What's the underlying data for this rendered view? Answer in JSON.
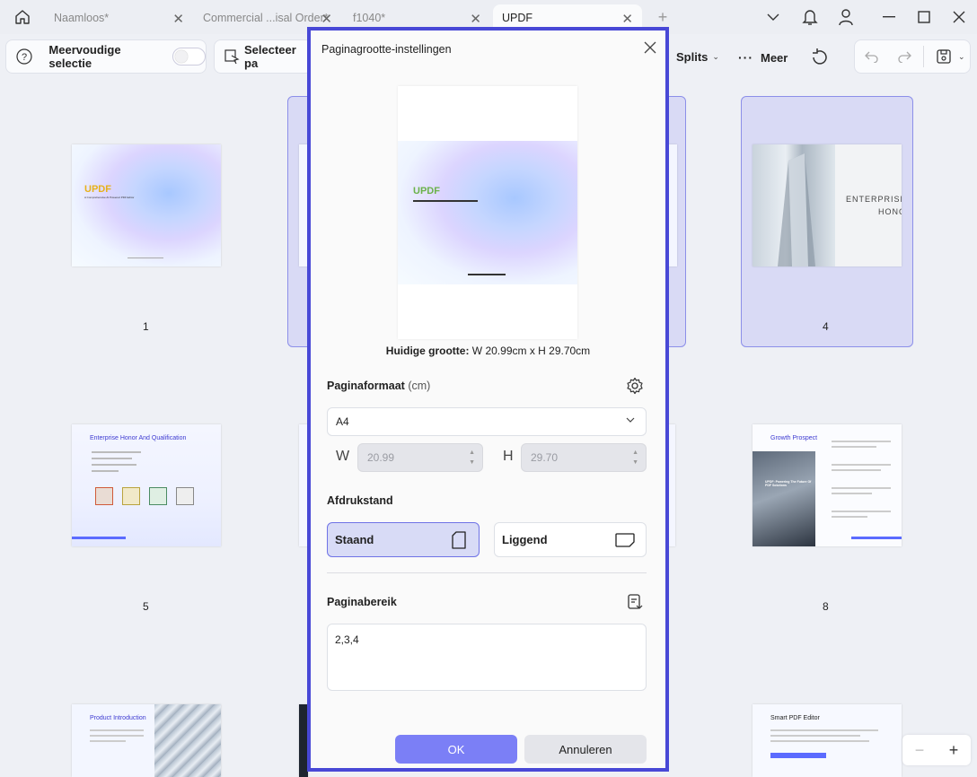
{
  "tabs": [
    {
      "label": "Naamloos*",
      "active": false
    },
    {
      "label": "Commercial ...isal Order*",
      "active": false
    },
    {
      "label": "f1040*",
      "active": false
    },
    {
      "label": "UPDF",
      "active": true
    }
  ],
  "toolbar": {
    "multi_select_label": "Meervoudige selectie",
    "select_pages_label": "Selecteer pa",
    "split_label": "Splits",
    "more_label": "Meer"
  },
  "pages": [
    {
      "number": "1",
      "brand": "UPDF",
      "subtitle": "A Comprehensive AI Powered PDF Editor"
    },
    {
      "number": "4",
      "title_line1": "ENTERPRISE",
      "title_line2": "HONOR"
    },
    {
      "number": "5",
      "title": "Enterprise Honor And Qualification"
    },
    {
      "number": "8",
      "title": "Growth Prospect",
      "banner": "UPDF: Powering The Future Of PDF Solutions"
    },
    {
      "title": "Product Introduction"
    },
    {
      "title": "Smart PDF Editor"
    }
  ],
  "dialog": {
    "title": "Paginagrootte-instellingen",
    "preview_brand": "UPDF",
    "current_size_label": "Huidige grootte:",
    "current_size_value": "W 20.99cm x H 29.70cm",
    "page_format_label": "Paginaformaat",
    "page_format_unit": "(cm)",
    "format_value": "A4",
    "width_label": "W",
    "width_value": "20.99",
    "height_label": "H",
    "height_value": "29.70",
    "orientation_label": "Afdrukstand",
    "portrait_label": "Staand",
    "landscape_label": "Liggend",
    "range_label": "Paginabereik",
    "range_value": "2,3,4",
    "ok_label": "OK",
    "cancel_label": "Annuleren"
  },
  "zoom": {
    "minus": "−",
    "plus": "+"
  },
  "colors": {
    "accent": "#4848d6",
    "ok_button": "#7b7ff6",
    "selected_card": "#d9daf5"
  }
}
